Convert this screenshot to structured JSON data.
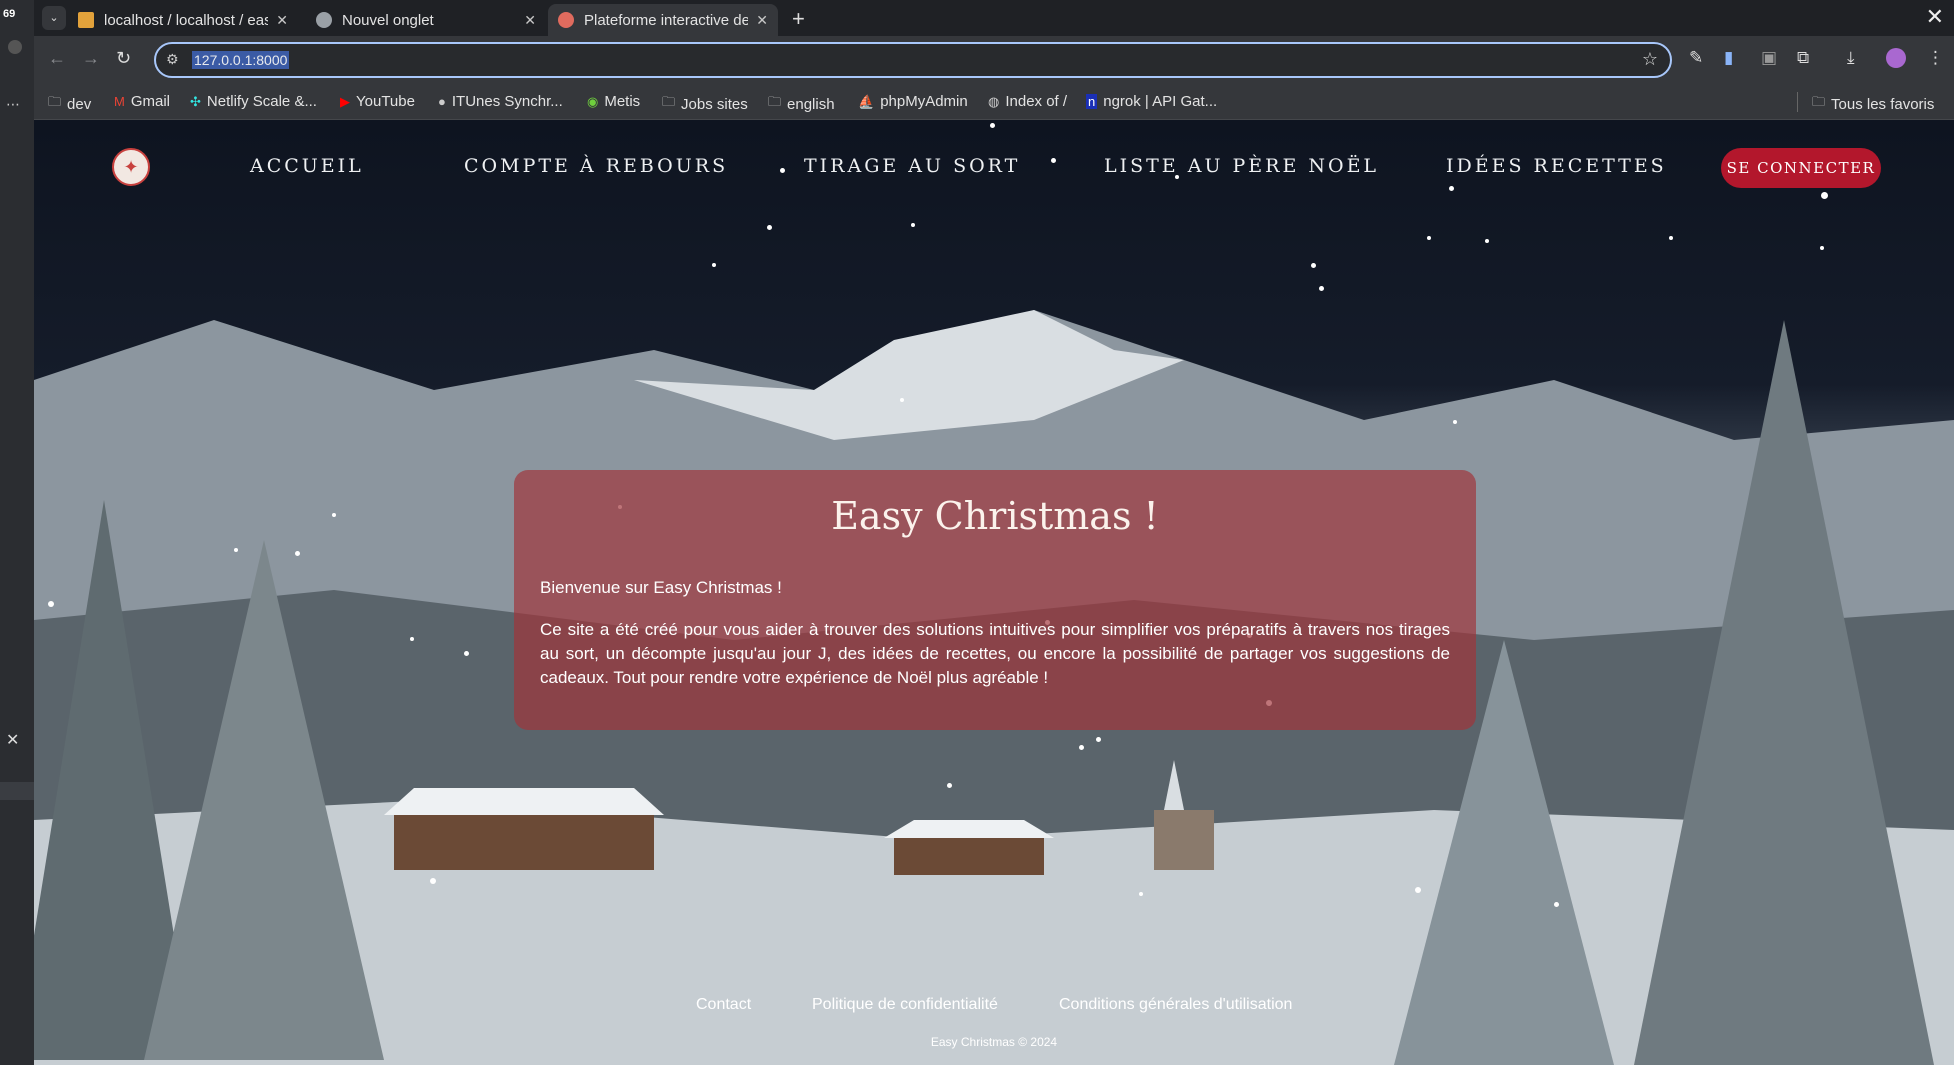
{
  "browser": {
    "tabs": [
      {
        "title": "localhost / localhost / eas",
        "icon": "phpmyadmin-icon",
        "active": false
      },
      {
        "title": "Nouvel onglet",
        "icon": "chrome-icon",
        "active": false
      },
      {
        "title": "Plateforme interactive de",
        "icon": "santa-icon",
        "active": true
      }
    ],
    "address": "127.0.0.1:8000",
    "bookmarks": [
      {
        "label": "dev",
        "icon": "folder-icon"
      },
      {
        "label": "Gmail",
        "icon": "gmail-icon"
      },
      {
        "label": "Netlify Scale &...",
        "icon": "netlify-icon"
      },
      {
        "label": "YouTube",
        "icon": "youtube-icon"
      },
      {
        "label": "ITUnes Synchr...",
        "icon": "apple-icon"
      },
      {
        "label": "Metis",
        "icon": "metis-icon"
      },
      {
        "label": "Jobs sites",
        "icon": "folder-icon"
      },
      {
        "label": "english",
        "icon": "folder-icon"
      },
      {
        "label": "phpMyAdmin",
        "icon": "phpmyadmin-icon"
      },
      {
        "label": "Index of /",
        "icon": "globe-icon"
      },
      {
        "label": "ngrok | API Gat...",
        "icon": "ngrok-icon"
      }
    ],
    "all_bookmarks": "Tous les favoris"
  },
  "site": {
    "nav": [
      "ACCUEIL",
      "COMPTE À REBOURS",
      "TIRAGE AU SORT",
      "LISTE AU PÈRE NOËL",
      "IDÉES RECETTES"
    ],
    "login": "SE CONNECTER",
    "card": {
      "title": "Easy Christmas !",
      "welcome": "Bienvenue sur Easy Christmas !",
      "text": "Ce site a été créé pour vous aider à trouver des solutions intuitives pour simplifier vos préparatifs à travers nos tirages au sort, un décompte jusqu'au jour J, des idées de recettes, ou encore la possibilité de partager vos suggestions de cadeaux. Tout pour rendre votre expérience de Noël plus agréable !"
    },
    "footer": {
      "links": [
        "Contact",
        "Politique de confidentialité",
        "Conditions générales d'utilisation"
      ],
      "copyright": "Easy Christmas © 2024"
    }
  },
  "colors": {
    "login_button": "#b3172c",
    "card_bg": "#a0343a"
  }
}
